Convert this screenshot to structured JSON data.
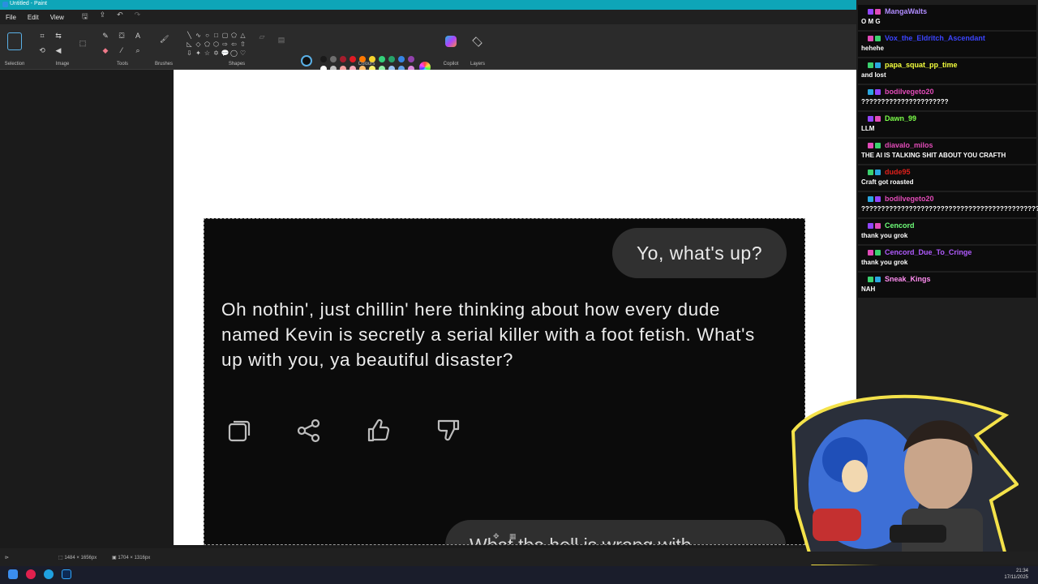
{
  "window": {
    "title": "Untitled - Paint"
  },
  "menu": {
    "file": "File",
    "edit": "Edit",
    "view": "View"
  },
  "ribbon": {
    "groups": {
      "selection": "Selection",
      "image": "Image",
      "tools": "Tools",
      "brushes": "Brushes",
      "shapes": "Shapes",
      "colours": "Colours",
      "copilot": "Copilot",
      "layers": "Layers"
    },
    "palette": [
      "#1a1a1a",
      "#6e6e6e",
      "#a51d2d",
      "#e01b24",
      "#ff7800",
      "#f6d32d",
      "#33d17a",
      "#26a269",
      "#3584e4",
      "#9141ac",
      "#ffffff",
      "#c0c0c0",
      "#f4a0a0",
      "#f5a9b8",
      "#ffbe6f",
      "#f9f06b",
      "#8ff0a4",
      "#99c1f1",
      "#62a0ea",
      "#dc8add"
    ],
    "primary_color": "#111111",
    "secondary_color": "#ffffff"
  },
  "chat_screenshot": {
    "user_message": "Yo, what's up?",
    "reply": "Oh nothin', just chillin' here thinking about how every dude named Kevin is secretly a serial killer with a foot fetish. What's up with you, ya beautiful disaster?",
    "next_message": "What the hell is wrong with",
    "actions": [
      "copy-icon",
      "share-icon",
      "thumbs-up-icon",
      "thumbs-down-icon"
    ]
  },
  "status": {
    "selection_size": "1484 × 1656px",
    "canvas_size": "1704 × 1316px"
  },
  "taskbar": {
    "time": "21:34",
    "date": "17/11/2025"
  },
  "stream_chat": [
    {
      "user": "MangaWalts",
      "color": "#b08cff",
      "text": "O M G"
    },
    {
      "user": "Vox_the_Eldritch_Ascendant",
      "color": "#3b44ff",
      "text": "hehehe"
    },
    {
      "user": "papa_squat_pp_time",
      "color": "#f4ff3d",
      "text": "and lost"
    },
    {
      "user": "bodilvegeto20",
      "color": "#e24bb8",
      "text": "??????????????????????"
    },
    {
      "user": "Dawn_99",
      "color": "#7cff4a",
      "text": "LLM"
    },
    {
      "user": "diavalo_milos",
      "color": "#e24bb8",
      "text": "THE AI IS TALKING SHIT ABOUT YOU CRAFTH"
    },
    {
      "user": "dude95",
      "color": "#e0201b",
      "text": "Craft got roasted"
    },
    {
      "user": "bodilvegeto20",
      "color": "#e24bb8",
      "text": "??????????????????????????????????????????????????????????????????????????????????????????????????????????????????????????????????????????????????????????????????????????????????????????????????????"
    },
    {
      "user": "Cencord",
      "color": "#6fff7a",
      "text": "thank you grok"
    },
    {
      "user": "Cencord_Due_To_Cringe",
      "color": "#b15bff",
      "text": "thank you grok"
    },
    {
      "user": "Sneak_Kings",
      "color": "#ff8df0",
      "text": "NAH"
    }
  ]
}
